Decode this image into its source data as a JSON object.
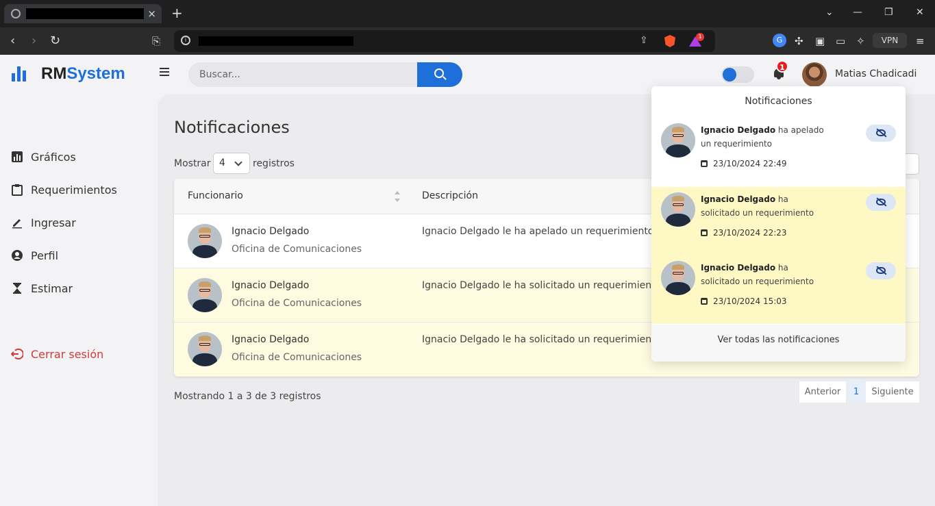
{
  "browser": {
    "new_tab": "+",
    "close_tab": "×",
    "shield_badge": "1",
    "vpn_label": "VPN",
    "translate_icon_label": "G"
  },
  "header": {
    "brand_rm": "RM",
    "brand_system": "System",
    "search_placeholder": "Buscar...",
    "notification_count": "1",
    "user_name": "Matias Chadicadi"
  },
  "sidebar": {
    "items": [
      {
        "label": "Gráficos",
        "icon": "bar-chart-icon"
      },
      {
        "label": "Requerimientos",
        "icon": "clipboard-icon"
      },
      {
        "label": "Ingresar",
        "icon": "pencil-icon"
      },
      {
        "label": "Perfil",
        "icon": "user-circle-icon"
      },
      {
        "label": "Estimar",
        "icon": "hourglass-icon"
      }
    ],
    "logout": "Cerrar sesión"
  },
  "main": {
    "title": "Notificaciones",
    "show_label": "Mostrar",
    "show_value": "4",
    "records_label": "registros",
    "columns": [
      "Funcionario",
      "Descripción"
    ],
    "rows": [
      {
        "name": "Ignacio Delgado",
        "office": "Oficina de Comunicaciones",
        "description": "Ignacio Delgado le ha apelado un requerimiento",
        "unread": false
      },
      {
        "name": "Ignacio Delgado",
        "office": "Oficina de Comunicaciones",
        "description": "Ignacio Delgado le ha solicitado un requerimien",
        "unread": true
      },
      {
        "name": "Ignacio Delgado",
        "office": "Oficina de Comunicaciones",
        "description": "Ignacio Delgado le ha solicitado un requerimien",
        "unread": true
      }
    ],
    "footer_info": "Mostrando 1 a 3 de 3 registros",
    "pagination": {
      "prev": "Anterior",
      "current": "1",
      "next": "Siguiente"
    }
  },
  "notifications": {
    "title": "Notificaciones",
    "items": [
      {
        "actor": "Ignacio Delgado",
        "action": " ha apelado un requerimiento",
        "date": "23/10/2024 22:49",
        "unread": false
      },
      {
        "actor": "Ignacio Delgado",
        "action": " ha solicitado un requerimiento",
        "date": "23/10/2024 22:23",
        "unread": true
      },
      {
        "actor": "Ignacio Delgado",
        "action": " ha solicitado un requerimiento",
        "date": "23/10/2024 15:03",
        "unread": true
      }
    ],
    "view_all": "Ver todas las notificaciones"
  },
  "colors": {
    "accent": "#1e6fd9",
    "danger": "#d03a3a",
    "unread_row": "#fefbe1",
    "unread_notification": "#fef8c5"
  }
}
